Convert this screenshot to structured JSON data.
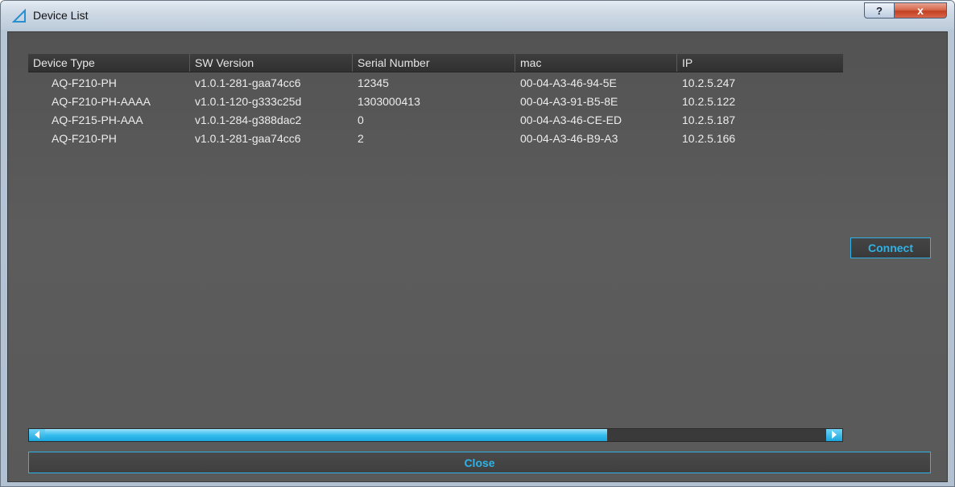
{
  "window": {
    "title": "Device List",
    "help_label": "?",
    "close_label": "x"
  },
  "table": {
    "columns": [
      "Device Type",
      "SW Version",
      "Serial Number",
      "mac",
      "IP"
    ],
    "rows": [
      [
        "AQ-F210-PH",
        "v1.0.1-281-gaa74cc6",
        "12345",
        "00-04-A3-46-94-5E",
        "10.2.5.247"
      ],
      [
        "AQ-F210-PH-AAAA",
        "v1.0.1-120-g333c25d",
        "1303000413",
        "00-04-A3-91-B5-8E",
        "10.2.5.122"
      ],
      [
        "AQ-F215-PH-AAA",
        "v1.0.1-284-g388dac2",
        "0",
        "00-04-A3-46-CE-ED",
        "10.2.5.187"
      ],
      [
        "AQ-F210-PH",
        "v1.0.1-281-gaa74cc6",
        "2",
        "00-04-A3-46-B9-A3",
        "10.2.5.166"
      ]
    ]
  },
  "buttons": {
    "connect": "Connect",
    "close": "Close"
  },
  "scrollbar": {
    "position_fraction": 0.72
  },
  "colors": {
    "accent": "#2fb2e6",
    "panel_bg": "#595959",
    "titlebar": "#c1cfdd",
    "close_red": "#c24022"
  }
}
